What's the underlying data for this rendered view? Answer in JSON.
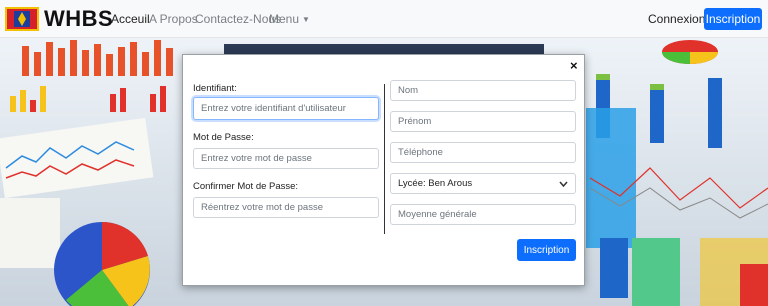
{
  "navbar": {
    "brand": "WHBS",
    "links": [
      {
        "label": "Acceuil"
      },
      {
        "label": "A Propos"
      },
      {
        "label": "Contactez-Nous"
      },
      {
        "label": "Menu"
      }
    ],
    "login": "Connexion",
    "signup": "Inscription"
  },
  "modal": {
    "close": "×",
    "left": {
      "id_label": "Identifiant:",
      "id_placeholder": "Entrez votre identifiant d'utilisateur",
      "pwd_label": "Mot de Passe:",
      "pwd_placeholder": "Entrez votre mot de passe",
      "confirm_label": "Confirmer Mot de Passe:",
      "confirm_placeholder": "Réentrez votre mot de passe"
    },
    "right": {
      "nom_placeholder": "Nom",
      "prenom_placeholder": "Prénom",
      "tel_placeholder": "Téléphone",
      "lycee_value": "Lycée: Ben Arous",
      "moyenne_placeholder": "Moyenne générale"
    },
    "submit": "Inscription"
  },
  "colors": {
    "primary": "#0d6efd",
    "navbar_bg": "#f8f9fa"
  }
}
